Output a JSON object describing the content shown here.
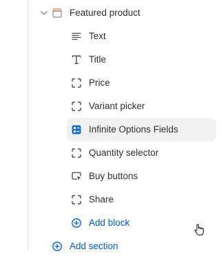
{
  "section": {
    "title": "Featured product",
    "chevron_icon": "chevron-down-icon",
    "section_icon": "product-section-icon"
  },
  "blocks": [
    {
      "label": "Text",
      "icon": "text-align-icon"
    },
    {
      "label": "Title",
      "icon": "title-t-icon"
    },
    {
      "label": "Price",
      "icon": "dashed-frame-icon"
    },
    {
      "label": "Variant picker",
      "icon": "dashed-frame-icon"
    },
    {
      "label": "Infinite Options Fields",
      "icon": "app-block-icon",
      "selected": true
    },
    {
      "label": "Quantity selector",
      "icon": "dashed-frame-icon"
    },
    {
      "label": "Buy buttons",
      "icon": "button-press-icon"
    },
    {
      "label": "Share",
      "icon": "dashed-frame-icon"
    }
  ],
  "add_block": {
    "label": "Add block",
    "icon": "plus-circle-icon"
  },
  "add_section": {
    "label": "Add section",
    "icon": "plus-circle-icon"
  },
  "colors": {
    "accent": "#005bd3",
    "app_icon": "#1f6fc5",
    "selected_bg": "#f1f1f1"
  }
}
